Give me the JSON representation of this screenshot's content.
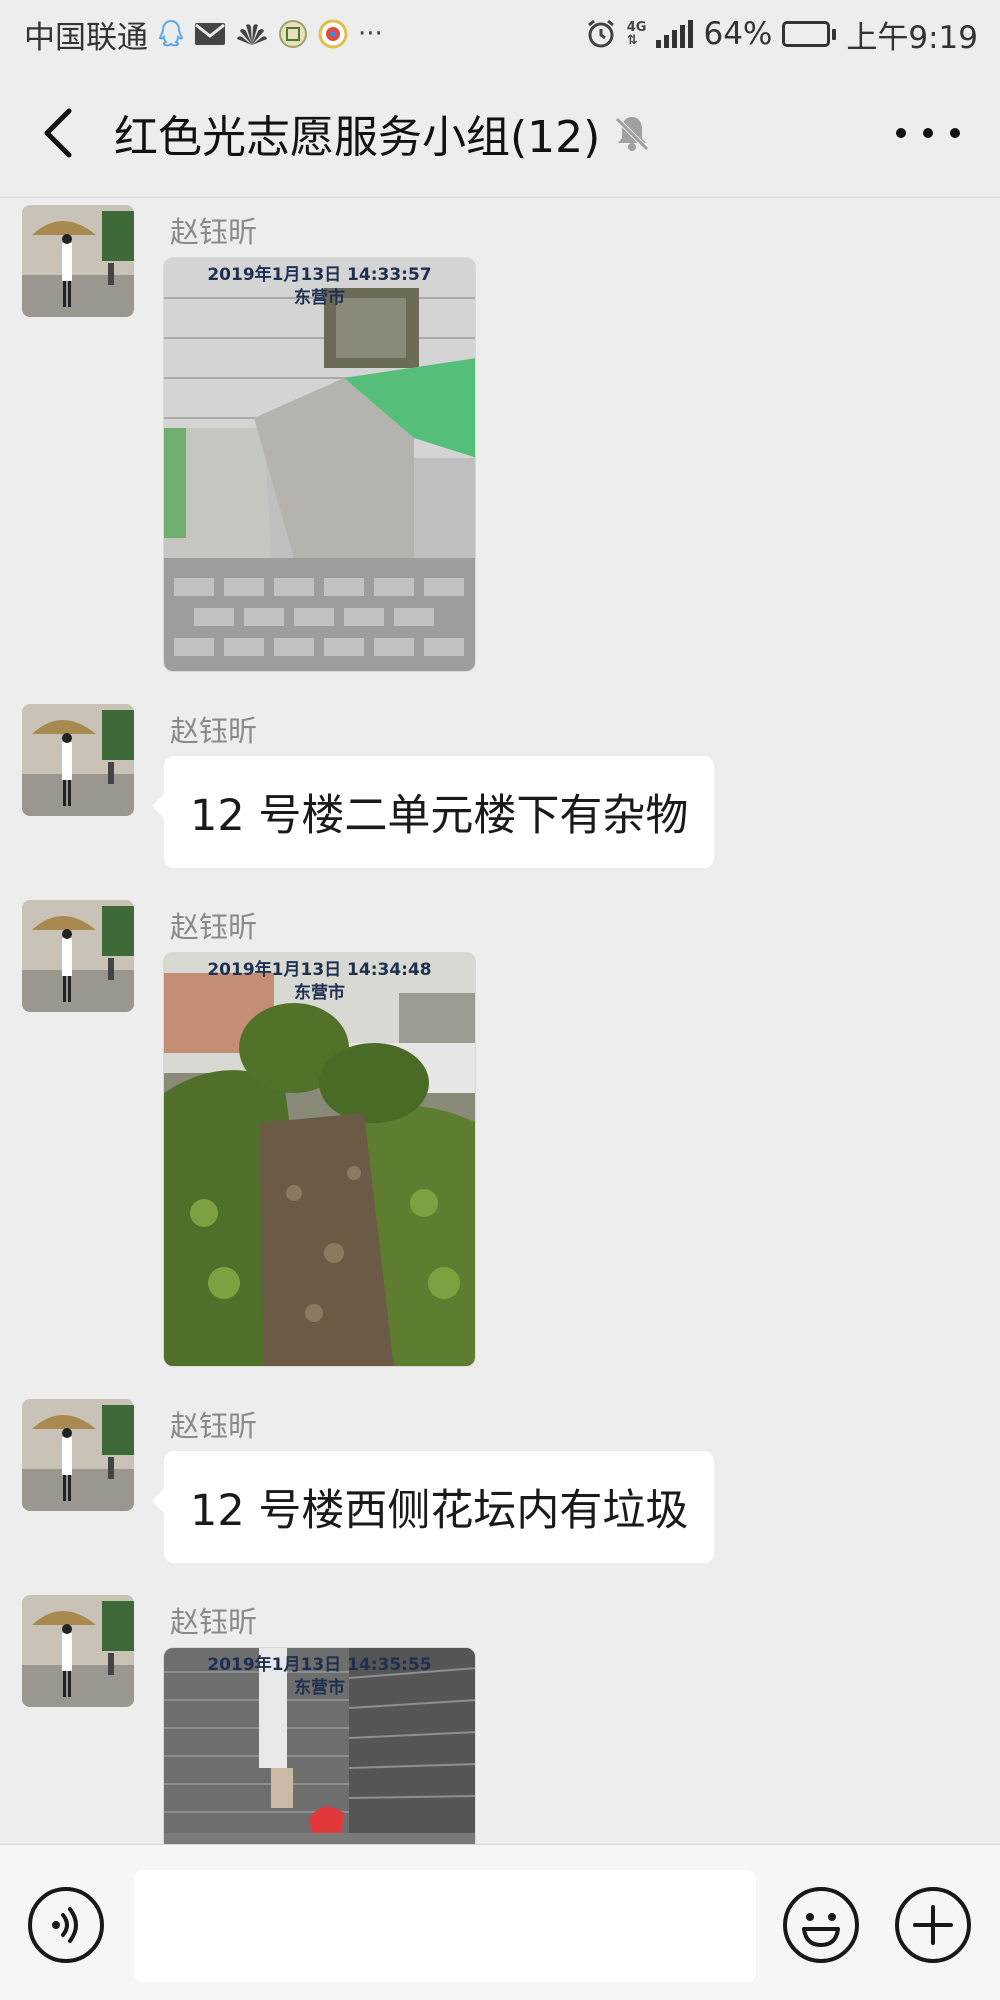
{
  "status_bar": {
    "carrier": "中国联通",
    "icons_left": [
      "qq-icon",
      "mail-icon",
      "huawei-icon",
      "app-icon",
      "weibo-icon",
      "more-notifications-icon"
    ],
    "more_indicator": "···",
    "network": "4G",
    "battery_percent": "64%",
    "battery_level": 0.64,
    "time": "上午9:19"
  },
  "header": {
    "title": "红色光志愿服务小组(12)"
  },
  "messages": [
    {
      "sender": "赵钰昕",
      "type": "image",
      "stamp_line1": "2019年1月13日 14:33:57",
      "stamp_line2": "东营市"
    },
    {
      "sender": "赵钰昕",
      "type": "text",
      "text": "12 号楼二单元楼下有杂物"
    },
    {
      "sender": "赵钰昕",
      "type": "image",
      "stamp_line1": "2019年1月13日 14:34:48",
      "stamp_line2": "东营市"
    },
    {
      "sender": "赵钰昕",
      "type": "text",
      "text": "12 号楼西侧花坛内有垃圾"
    },
    {
      "sender": "赵钰昕",
      "type": "image",
      "stamp_line1": "2019年1月13日 14:35:55",
      "stamp_line2": "东营市"
    }
  ],
  "input_bar": {
    "input_value": ""
  },
  "colors": {
    "background": "#ededed",
    "bubble": "#ffffff",
    "bottom_bar": "#f6f6f6"
  }
}
